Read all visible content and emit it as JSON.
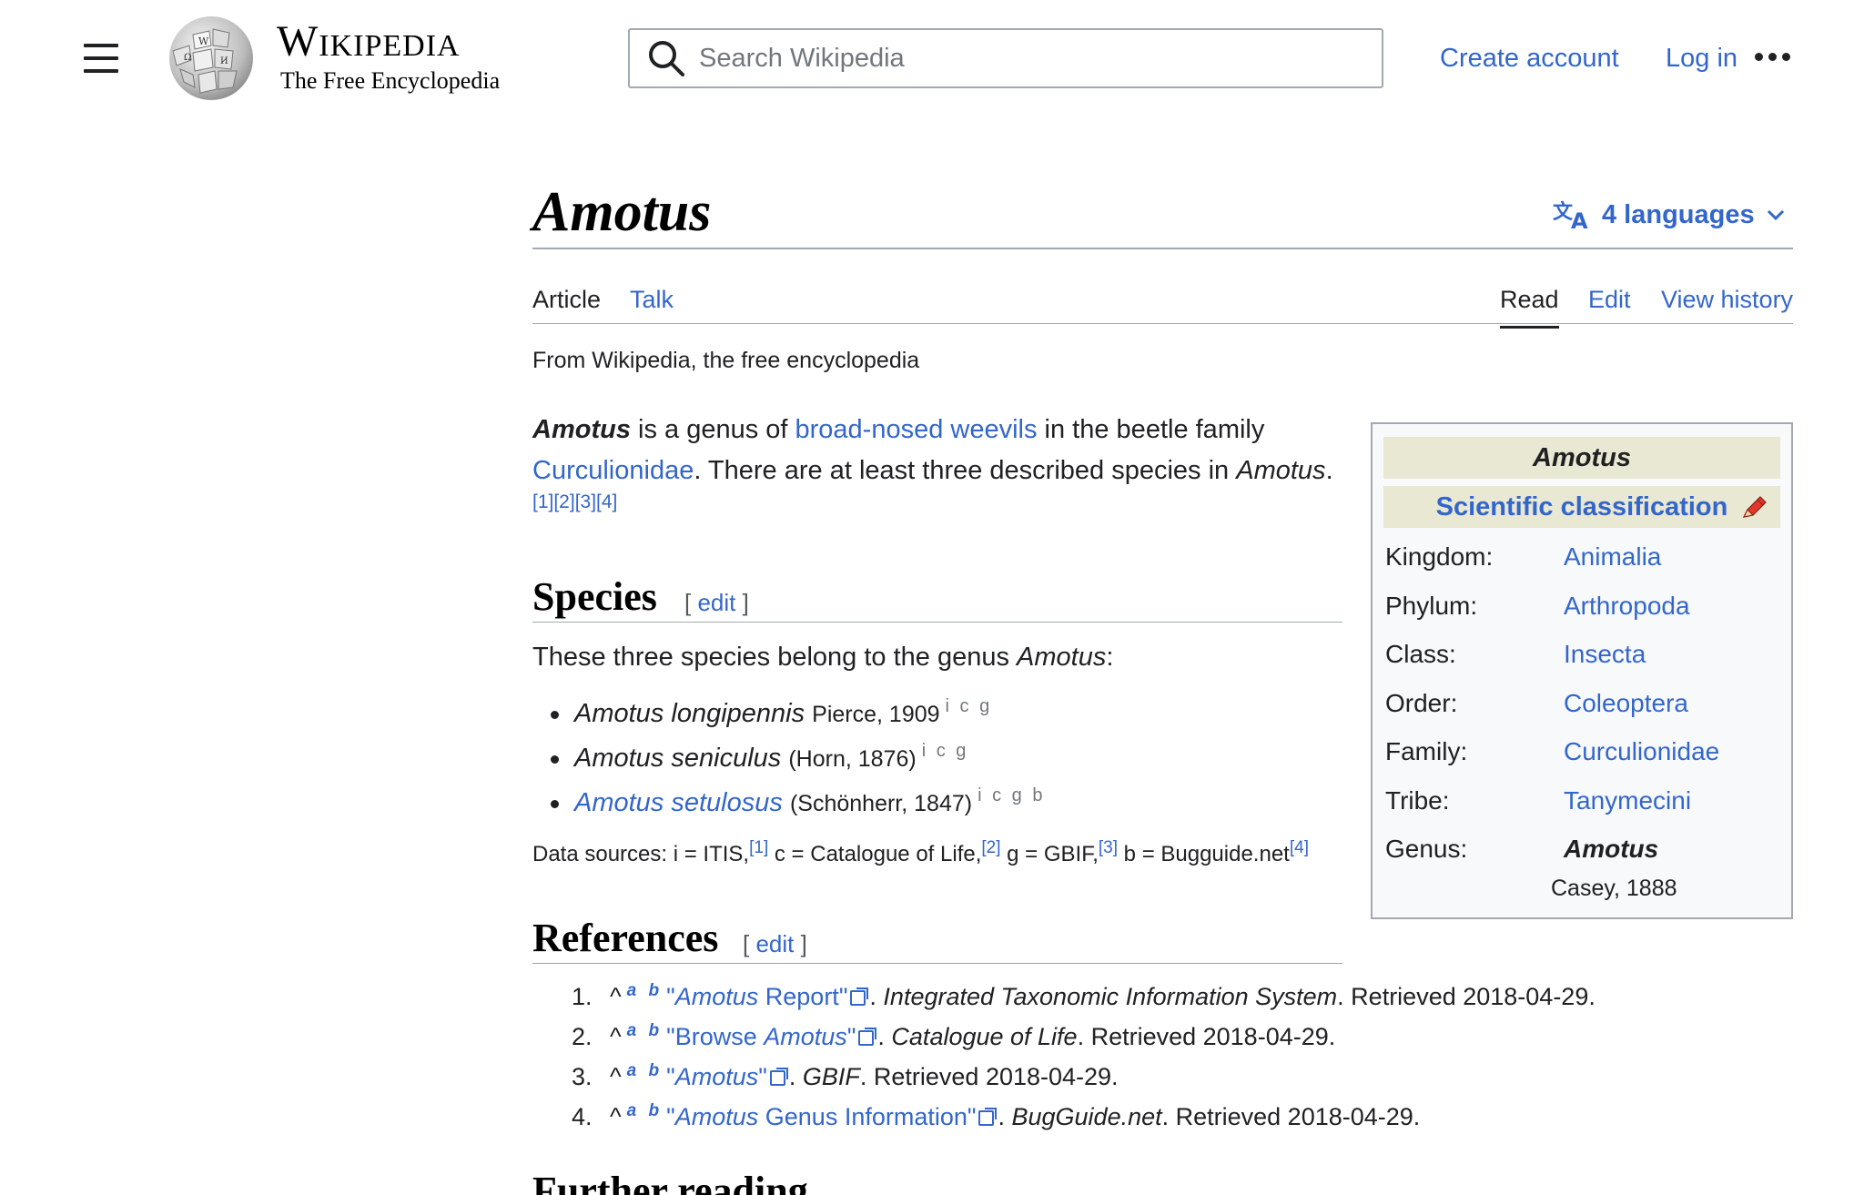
{
  "header": {
    "site_name": "Wikipedia",
    "tagline": "The Free Encyclopedia",
    "search_placeholder": "Search Wikipedia",
    "create_account": "Create account",
    "log_in": "Log in"
  },
  "page": {
    "title": "Amotus",
    "languages": "4 languages",
    "tabs": {
      "article": "Article",
      "talk": "Talk",
      "read": "Read",
      "edit": "Edit",
      "history": "View history"
    },
    "from": "From Wikipedia, the free encyclopedia"
  },
  "intro": {
    "bold": "Amotus",
    "t1": " is a genus of ",
    "link1": "broad-nosed weevils",
    "t2": " in the beetle family",
    "link2": "Curculionidae",
    "t3": ". There are at least three described species in ",
    "italic": "Amotus",
    "t4": ".",
    "refs": "[1][2][3][4]"
  },
  "species": {
    "heading": "Species",
    "edit": "edit",
    "lead_text": "These three species belong to the genus ",
    "lead_italic": "Amotus",
    "lead_end": ":",
    "items": [
      {
        "name": "Amotus longipennis",
        "authority": "Pierce, 1909",
        "sources": "i c g"
      },
      {
        "name": "Amotus seniculus",
        "authority": "(Horn, 1876)",
        "sources": "i c g"
      },
      {
        "name": "Amotus setulosus",
        "authority": "(Schönherr, 1847)",
        "sources": "i c g b"
      }
    ],
    "data_sources": {
      "prefix": "Data sources: i = ITIS,",
      "r1": "[1]",
      "c": " c = Catalogue of Life,",
      "r2": "[2]",
      "g": " g = GBIF,",
      "r3": "[3]",
      "b": " b = Bugguide.net",
      "r4": "[4]"
    }
  },
  "references": {
    "heading": "References",
    "edit": "edit",
    "items": [
      {
        "num": "1.",
        "q1": "\"",
        "link_italic": "Amotus",
        "link_rest": " Report",
        "q2": "\"",
        "pub": "Integrated Taxonomic Information System",
        "retrieved": ". Retrieved 2018-04-29."
      },
      {
        "num": "2.",
        "q1": "\"",
        "link_pre": "Browse ",
        "link_italic": "Amotus",
        "q2": "\"",
        "pub": "Catalogue of Life",
        "retrieved": ". Retrieved 2018-04-29."
      },
      {
        "num": "3.",
        "q1": "\"",
        "link_italic": "Amotus",
        "q2": "\"",
        "pub": "GBIF",
        "retrieved": ". Retrieved 2018-04-29."
      },
      {
        "num": "4.",
        "q1": "\"",
        "link_italic": "Amotus",
        "link_rest": " Genus Information",
        "q2": "\"",
        "pub": "BugGuide.net",
        "retrieved": ". Retrieved 2018-04-29."
      }
    ],
    "caret": "^",
    "ab": "a b"
  },
  "infobox": {
    "title": "Amotus",
    "classification": "Scientific classification",
    "rows": [
      {
        "label": "Kingdom:",
        "value": "Animalia"
      },
      {
        "label": "Phylum:",
        "value": "Arthropoda"
      },
      {
        "label": "Class:",
        "value": "Insecta"
      },
      {
        "label": "Order:",
        "value": "Coleoptera"
      },
      {
        "label": "Family:",
        "value": "Curculionidae"
      },
      {
        "label": "Tribe:",
        "value": "Tanymecini"
      },
      {
        "label": "Genus:",
        "value": "Amotus"
      }
    ],
    "authority": "Casey, 1888"
  },
  "further_reading": {
    "heading": "Further reading"
  },
  "colors": {
    "link": "#3366cc",
    "text": "#202122",
    "rule": "#a2a9b1",
    "infobox_header": "#e9e8d3"
  }
}
